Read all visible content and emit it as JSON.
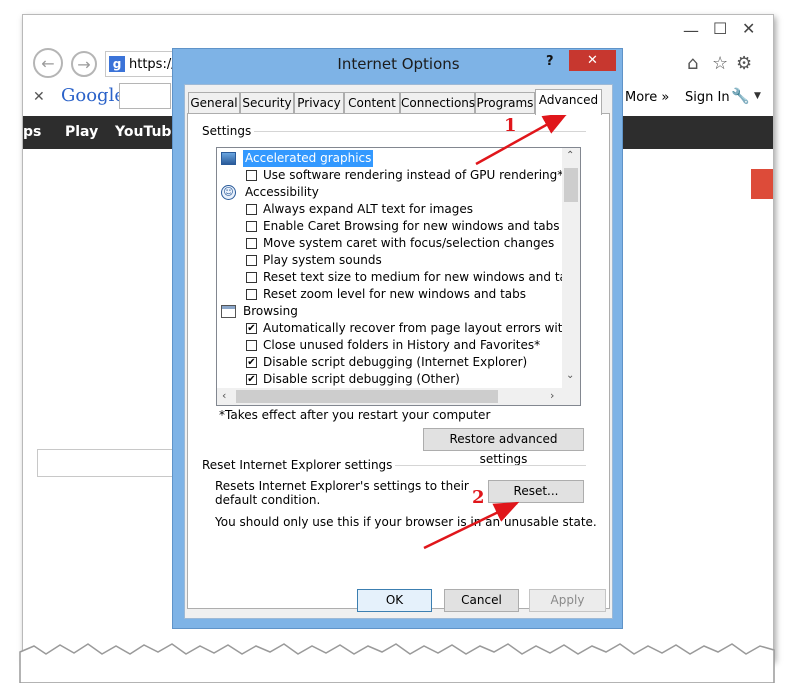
{
  "browser": {
    "address_text": "https://",
    "more_label": "More »",
    "sign_in_label": "Sign In",
    "google_logo_text": "Google",
    "google_bar_items": [
      "ps",
      "Play",
      "YouTube"
    ]
  },
  "dialog": {
    "title": "Internet Options",
    "help_label": "?",
    "close_label": "✕",
    "tabs": [
      "General",
      "Security",
      "Privacy",
      "Content",
      "Connections",
      "Programs",
      "Advanced"
    ],
    "active_tab": "Advanced",
    "settings_group_label": "Settings",
    "settings_list": [
      {
        "type": "category",
        "label": "Accelerated graphics",
        "selected": true
      },
      {
        "type": "option",
        "label": "Use software rendering instead of GPU rendering*",
        "checked": false
      },
      {
        "type": "category",
        "label": "Accessibility"
      },
      {
        "type": "option",
        "label": "Always expand ALT text for images",
        "checked": false
      },
      {
        "type": "option",
        "label": "Enable Caret Browsing for new windows and tabs",
        "checked": false
      },
      {
        "type": "option",
        "label": "Move system caret with focus/selection changes",
        "checked": false
      },
      {
        "type": "option",
        "label": "Play system sounds",
        "checked": false
      },
      {
        "type": "option",
        "label": "Reset text size to medium for new windows and tabs",
        "checked": false
      },
      {
        "type": "option",
        "label": "Reset zoom level for new windows and tabs",
        "checked": false
      },
      {
        "type": "category",
        "label": "Browsing"
      },
      {
        "type": "option",
        "label": "Automatically recover from page layout errors with Compa",
        "checked": true
      },
      {
        "type": "option",
        "label": "Close unused folders in History and Favorites*",
        "checked": false
      },
      {
        "type": "option",
        "label": "Disable script debugging (Internet Explorer)",
        "checked": true
      },
      {
        "type": "option",
        "label": "Disable script debugging (Other)",
        "checked": true
      }
    ],
    "restart_note": "*Takes effect after you restart your computer",
    "restore_button": "Restore advanced settings",
    "reset_group_label": "Reset Internet Explorer settings",
    "reset_desc": "Resets Internet Explorer's settings to their default condition.",
    "reset_button": "Reset...",
    "reset_warning": "You should only use this if your browser is in an unusable state.",
    "ok_button": "OK",
    "cancel_button": "Cancel",
    "apply_button": "Apply"
  },
  "annotations": {
    "step1": "1",
    "step2": "2",
    "arrow_color": "#e0161b"
  },
  "icons": {
    "back": "back-arrow-icon",
    "forward": "forward-arrow-icon",
    "home": "home-icon",
    "favorites": "star-icon",
    "tools": "gear-icon"
  }
}
